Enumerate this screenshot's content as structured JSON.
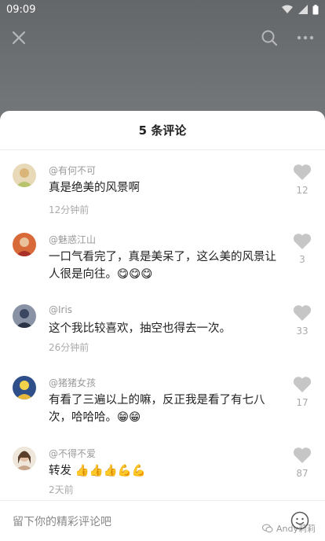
{
  "status_bar": {
    "time": "09:09"
  },
  "sheet": {
    "title": "5 条评论"
  },
  "comments": [
    {
      "user": "@有何不可",
      "text": "真是绝美的风景啊",
      "time": "12分钟前",
      "likes": "12",
      "avatar_color": "#d9b57a"
    },
    {
      "user": "@魅惑江山",
      "text": "一口气看完了，真是美呆了，这么美的风景让人很是向往。😋😋😋",
      "time": "",
      "likes": "3",
      "avatar_color": "#b0422f"
    },
    {
      "user": "@Iris",
      "text": "这个我比较喜欢，抽空也得去一次。",
      "time": "26分钟前",
      "likes": "33",
      "avatar_color": "#3b4660"
    },
    {
      "user": "@猪猪女孩",
      "text": "有看了三遍以上的嘛，反正我是看了有七八次，哈哈哈。😁😁",
      "time": "",
      "likes": "17",
      "avatar_color": "#2f4f8a"
    },
    {
      "user": "@不得不爱",
      "text": "转发 👍👍👍💪💪",
      "time": "2天前",
      "likes": "87",
      "avatar_color": "#c9a58c"
    }
  ],
  "input": {
    "placeholder": "留下你的精彩评论吧"
  },
  "watermark": {
    "text": "Andy莉莉"
  },
  "icons": [
    "close-icon",
    "search-icon",
    "more-icon",
    "heart-icon",
    "emoji-icon",
    "wifi-icon",
    "signal-icon",
    "battery-icon"
  ]
}
